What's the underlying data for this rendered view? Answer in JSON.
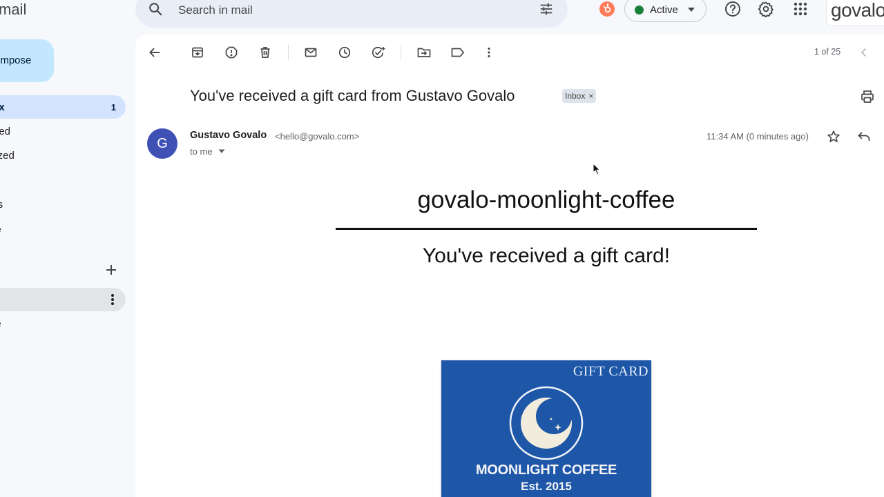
{
  "app": {
    "name": "mail"
  },
  "search": {
    "placeholder": "Search in mail"
  },
  "status": {
    "label": "Active",
    "color": "#188038"
  },
  "brand": {
    "logo_text": "govalo"
  },
  "nav": {
    "compose_label": "ompose",
    "items": [
      {
        "label": "box",
        "count": "1",
        "selected": true
      },
      {
        "label": "arred"
      },
      {
        "label": "oozed"
      },
      {
        "label": "nt"
      },
      {
        "label": "afts"
      },
      {
        "label": "ore"
      }
    ],
    "labels": [
      {
        "label": "ult"
      },
      {
        "label": "ore"
      }
    ]
  },
  "toolbar": {
    "pager": "1 of 25"
  },
  "message": {
    "subject": "You've received a gift card from Gustavo Govalo",
    "chip": "Inbox",
    "chip_close": "×",
    "avatar_letter": "G",
    "sender_name": "Gustavo Govalo",
    "sender_email": "<hello@govalo.com>",
    "recipient": "to me",
    "time": "11:34 AM (0 minutes ago)"
  },
  "body": {
    "brand_title": "govalo-moonlight-coffee",
    "heading": "You've received a gift card!",
    "card": {
      "label": "GIFT CARD",
      "shop_name": "MOONLIGHT COFFEE",
      "established": "Est. 2015",
      "color": "#1e56a8"
    }
  },
  "icons": [
    "search-icon",
    "tune-icon",
    "hubspot-icon",
    "help-icon",
    "settings-icon",
    "apps-icon",
    "back-icon",
    "archive-icon",
    "report-spam-icon",
    "delete-icon",
    "mark-unread-icon",
    "snooze-icon",
    "add-task-icon",
    "move-to-icon",
    "label-icon",
    "more-vert-icon",
    "chevron-left-icon",
    "print-icon",
    "star-icon",
    "reply-icon",
    "plus-icon",
    "moon-icon"
  ]
}
